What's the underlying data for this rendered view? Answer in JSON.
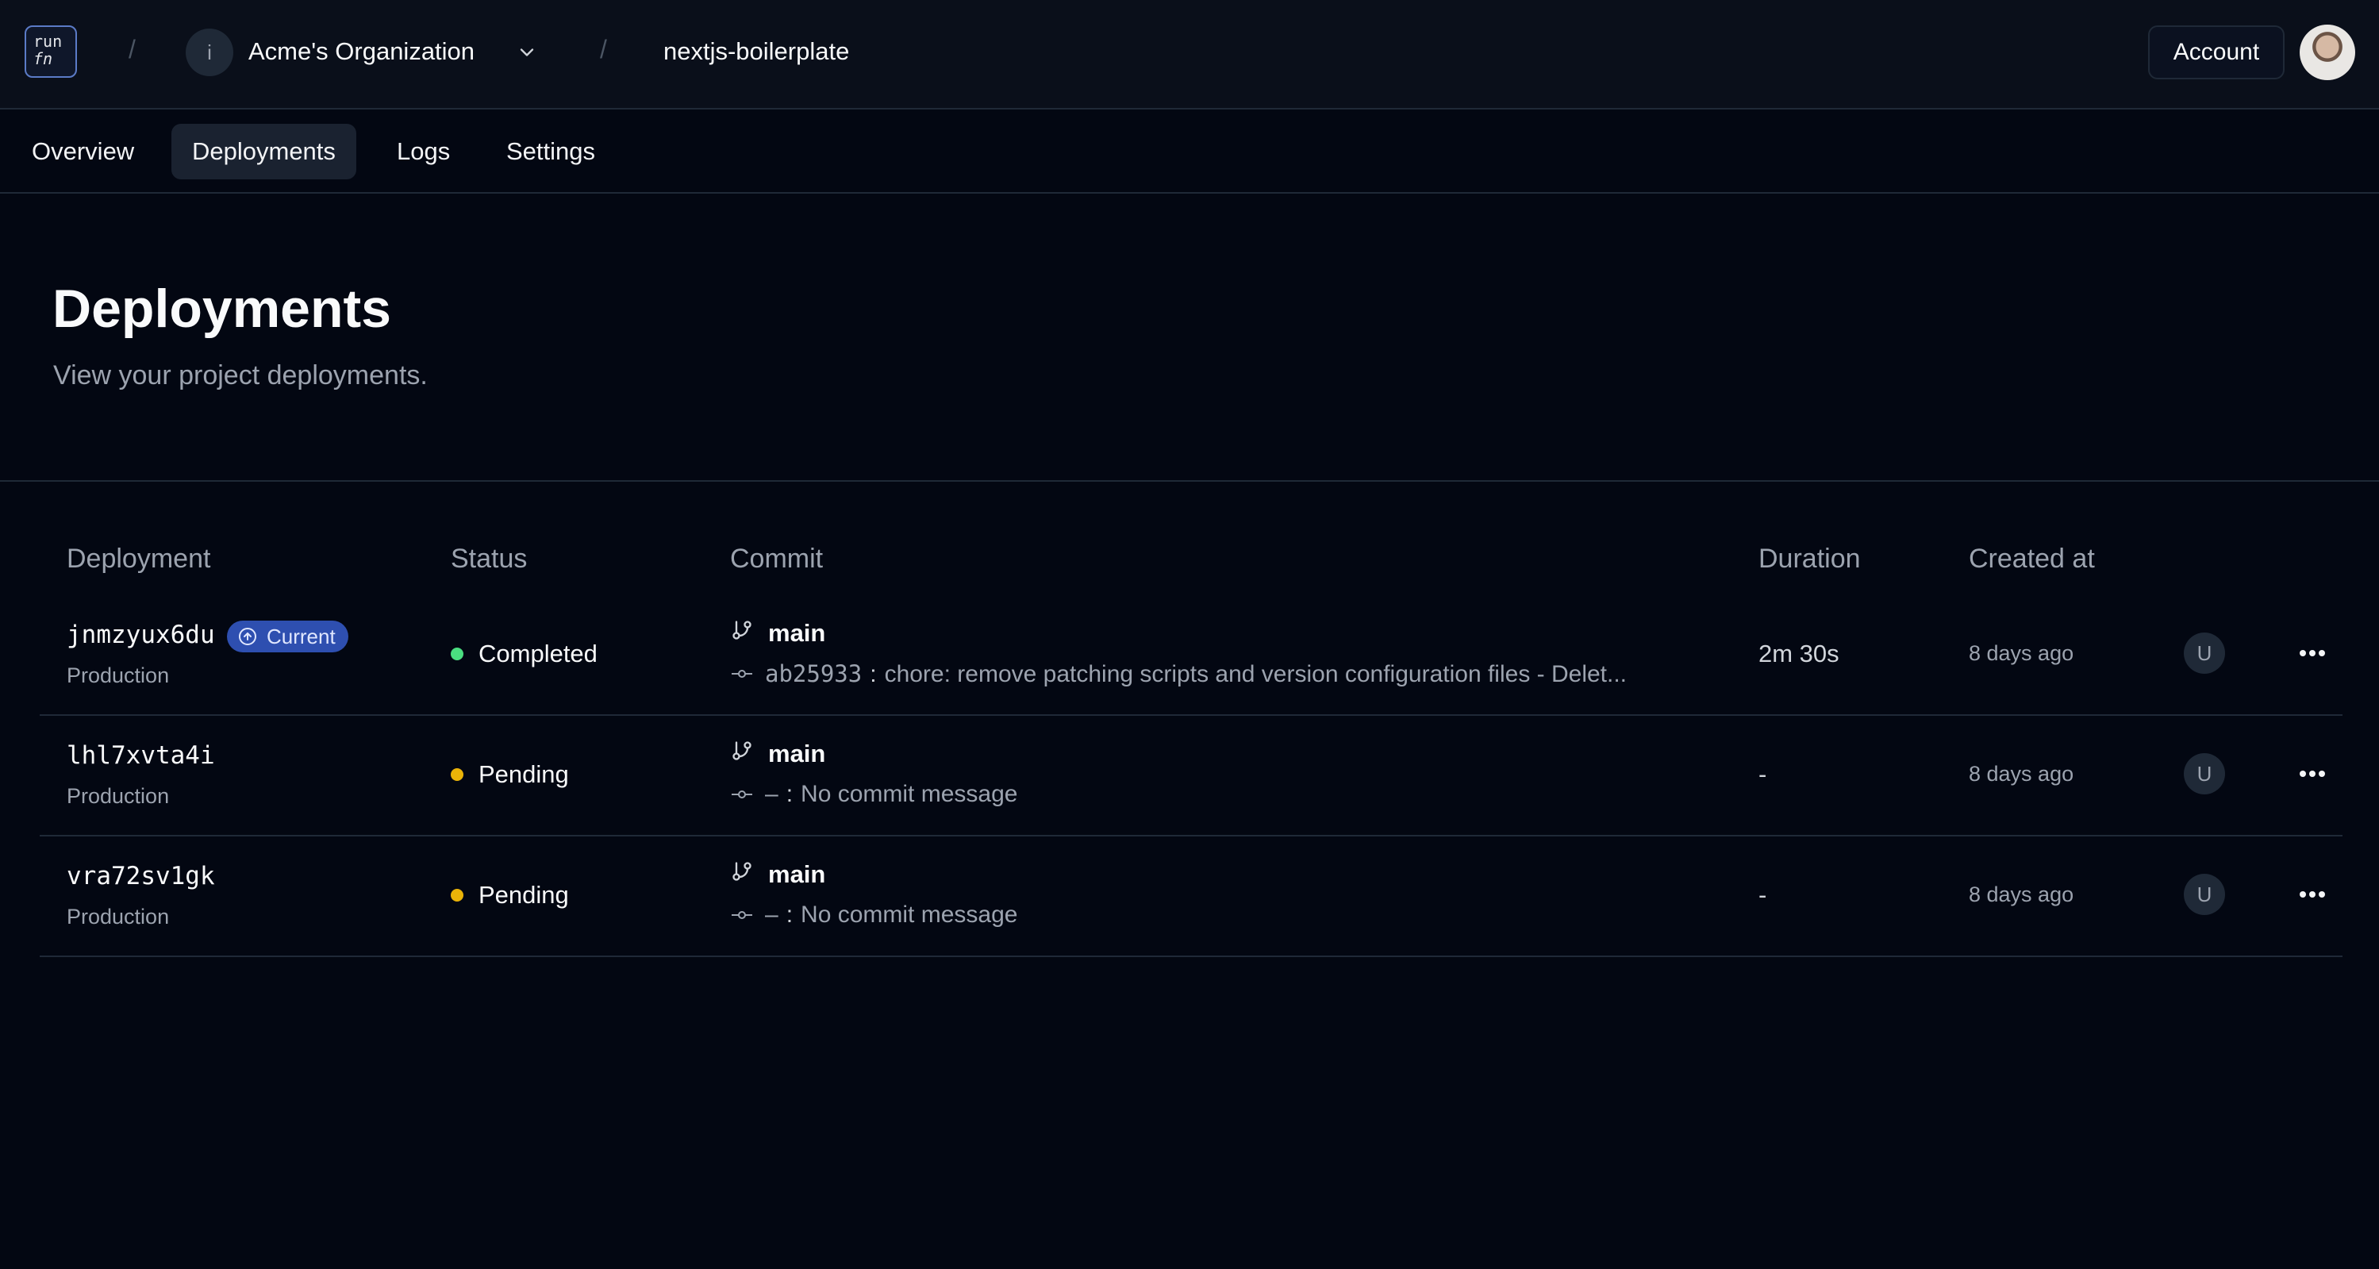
{
  "header": {
    "logo": {
      "line1": "run",
      "line2": "fn"
    },
    "breadcrumb_separator": "/",
    "org_initial": "i",
    "org_name": "Acme's Organization",
    "project_name": "nextjs-boilerplate",
    "account_label": "Account"
  },
  "tabs": [
    {
      "label": "Overview",
      "active": false
    },
    {
      "label": "Deployments",
      "active": true
    },
    {
      "label": "Logs",
      "active": false
    },
    {
      "label": "Settings",
      "active": false
    }
  ],
  "page": {
    "title": "Deployments",
    "subtitle": "View your project deployments."
  },
  "table": {
    "columns": [
      "Deployment",
      "Status",
      "Commit",
      "Duration",
      "Created at"
    ],
    "rows": [
      {
        "id": "jnmzyux6du",
        "badge": "Current",
        "environment": "Production",
        "status": "Completed",
        "status_color": "#4ade80",
        "branch": "main",
        "commit_hash": "ab25933",
        "commit_message": "chore: remove patching scripts and version configuration files - Delet...",
        "duration": "2m 30s",
        "created": "8 days ago",
        "user_initial": "U"
      },
      {
        "id": "lhl7xvta4i",
        "badge": "",
        "environment": "Production",
        "status": "Pending",
        "status_color": "#eab308",
        "branch": "main",
        "commit_hash": "–",
        "commit_message": "No commit message",
        "duration": "-",
        "created": "8 days ago",
        "user_initial": "U"
      },
      {
        "id": "vra72sv1gk",
        "badge": "",
        "environment": "Production",
        "status": "Pending",
        "status_color": "#eab308",
        "branch": "main",
        "commit_hash": "–",
        "commit_message": "No commit message",
        "duration": "-",
        "created": "8 days ago",
        "user_initial": "U"
      }
    ],
    "commit_separator": ":"
  },
  "icons": [
    "chevron-down-icon",
    "branch-icon",
    "commit-icon",
    "arrow-up-circle-icon",
    "more-horizontal-icon"
  ],
  "colors": {
    "background": "#030712",
    "badge": "#2e4fb0",
    "completed": "#4ade80",
    "pending": "#eab308"
  }
}
